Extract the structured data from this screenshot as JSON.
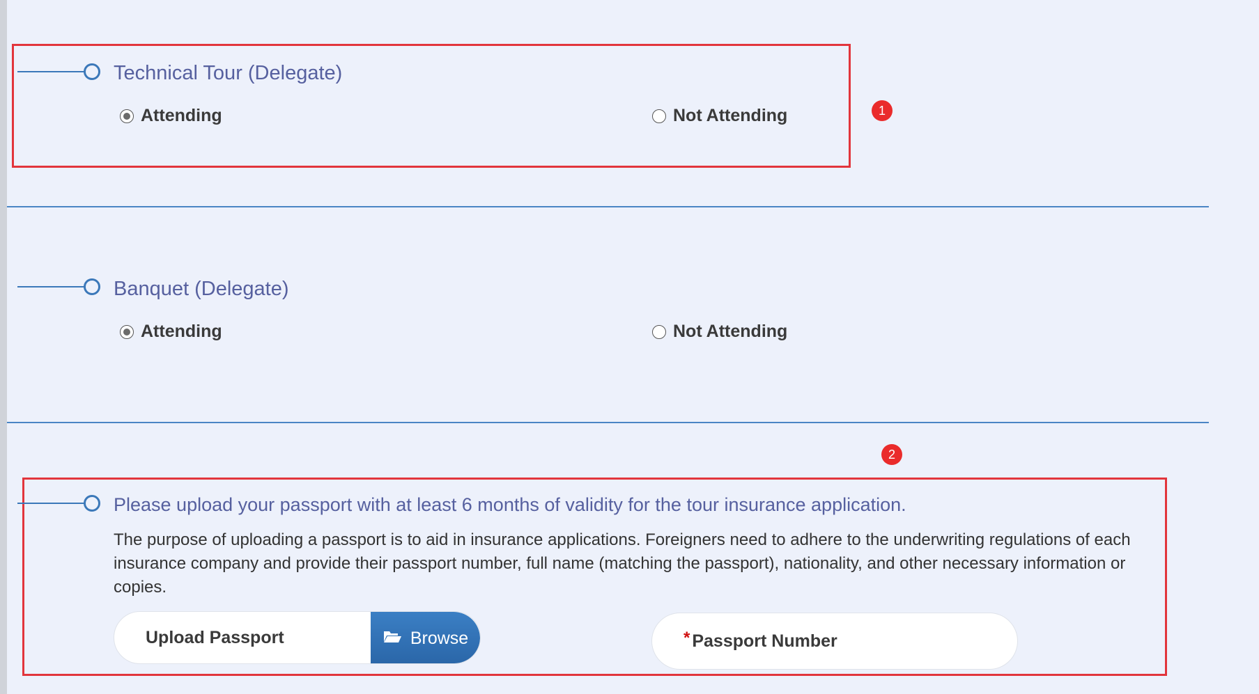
{
  "sections": [
    {
      "title": "Technical Tour (Delegate)",
      "options": [
        {
          "label": "Attending",
          "selected": true
        },
        {
          "label": "Not Attending",
          "selected": false
        }
      ]
    },
    {
      "title": "Banquet (Delegate)",
      "options": [
        {
          "label": "Attending",
          "selected": true
        },
        {
          "label": "Not Attending",
          "selected": false
        }
      ]
    },
    {
      "title": "Please upload your passport with at least 6 months of validity for the tour insurance application.",
      "description": "The purpose of uploading a passport is to aid in insurance applications. Foreigners need to adhere to the underwriting regulations of each insurance company and provide their passport number, full name (matching the passport), nationality, and other necessary information or copies.",
      "upload_label": "Upload Passport",
      "browse_label": "Browse",
      "passport_number_label": "Passport Number",
      "required_mark": "*"
    }
  ],
  "annotations": [
    "1",
    "2"
  ],
  "colors": {
    "background": "#edf1fb",
    "accent": "#3b78b9",
    "title": "#56609f",
    "callout": "#e2353c"
  }
}
